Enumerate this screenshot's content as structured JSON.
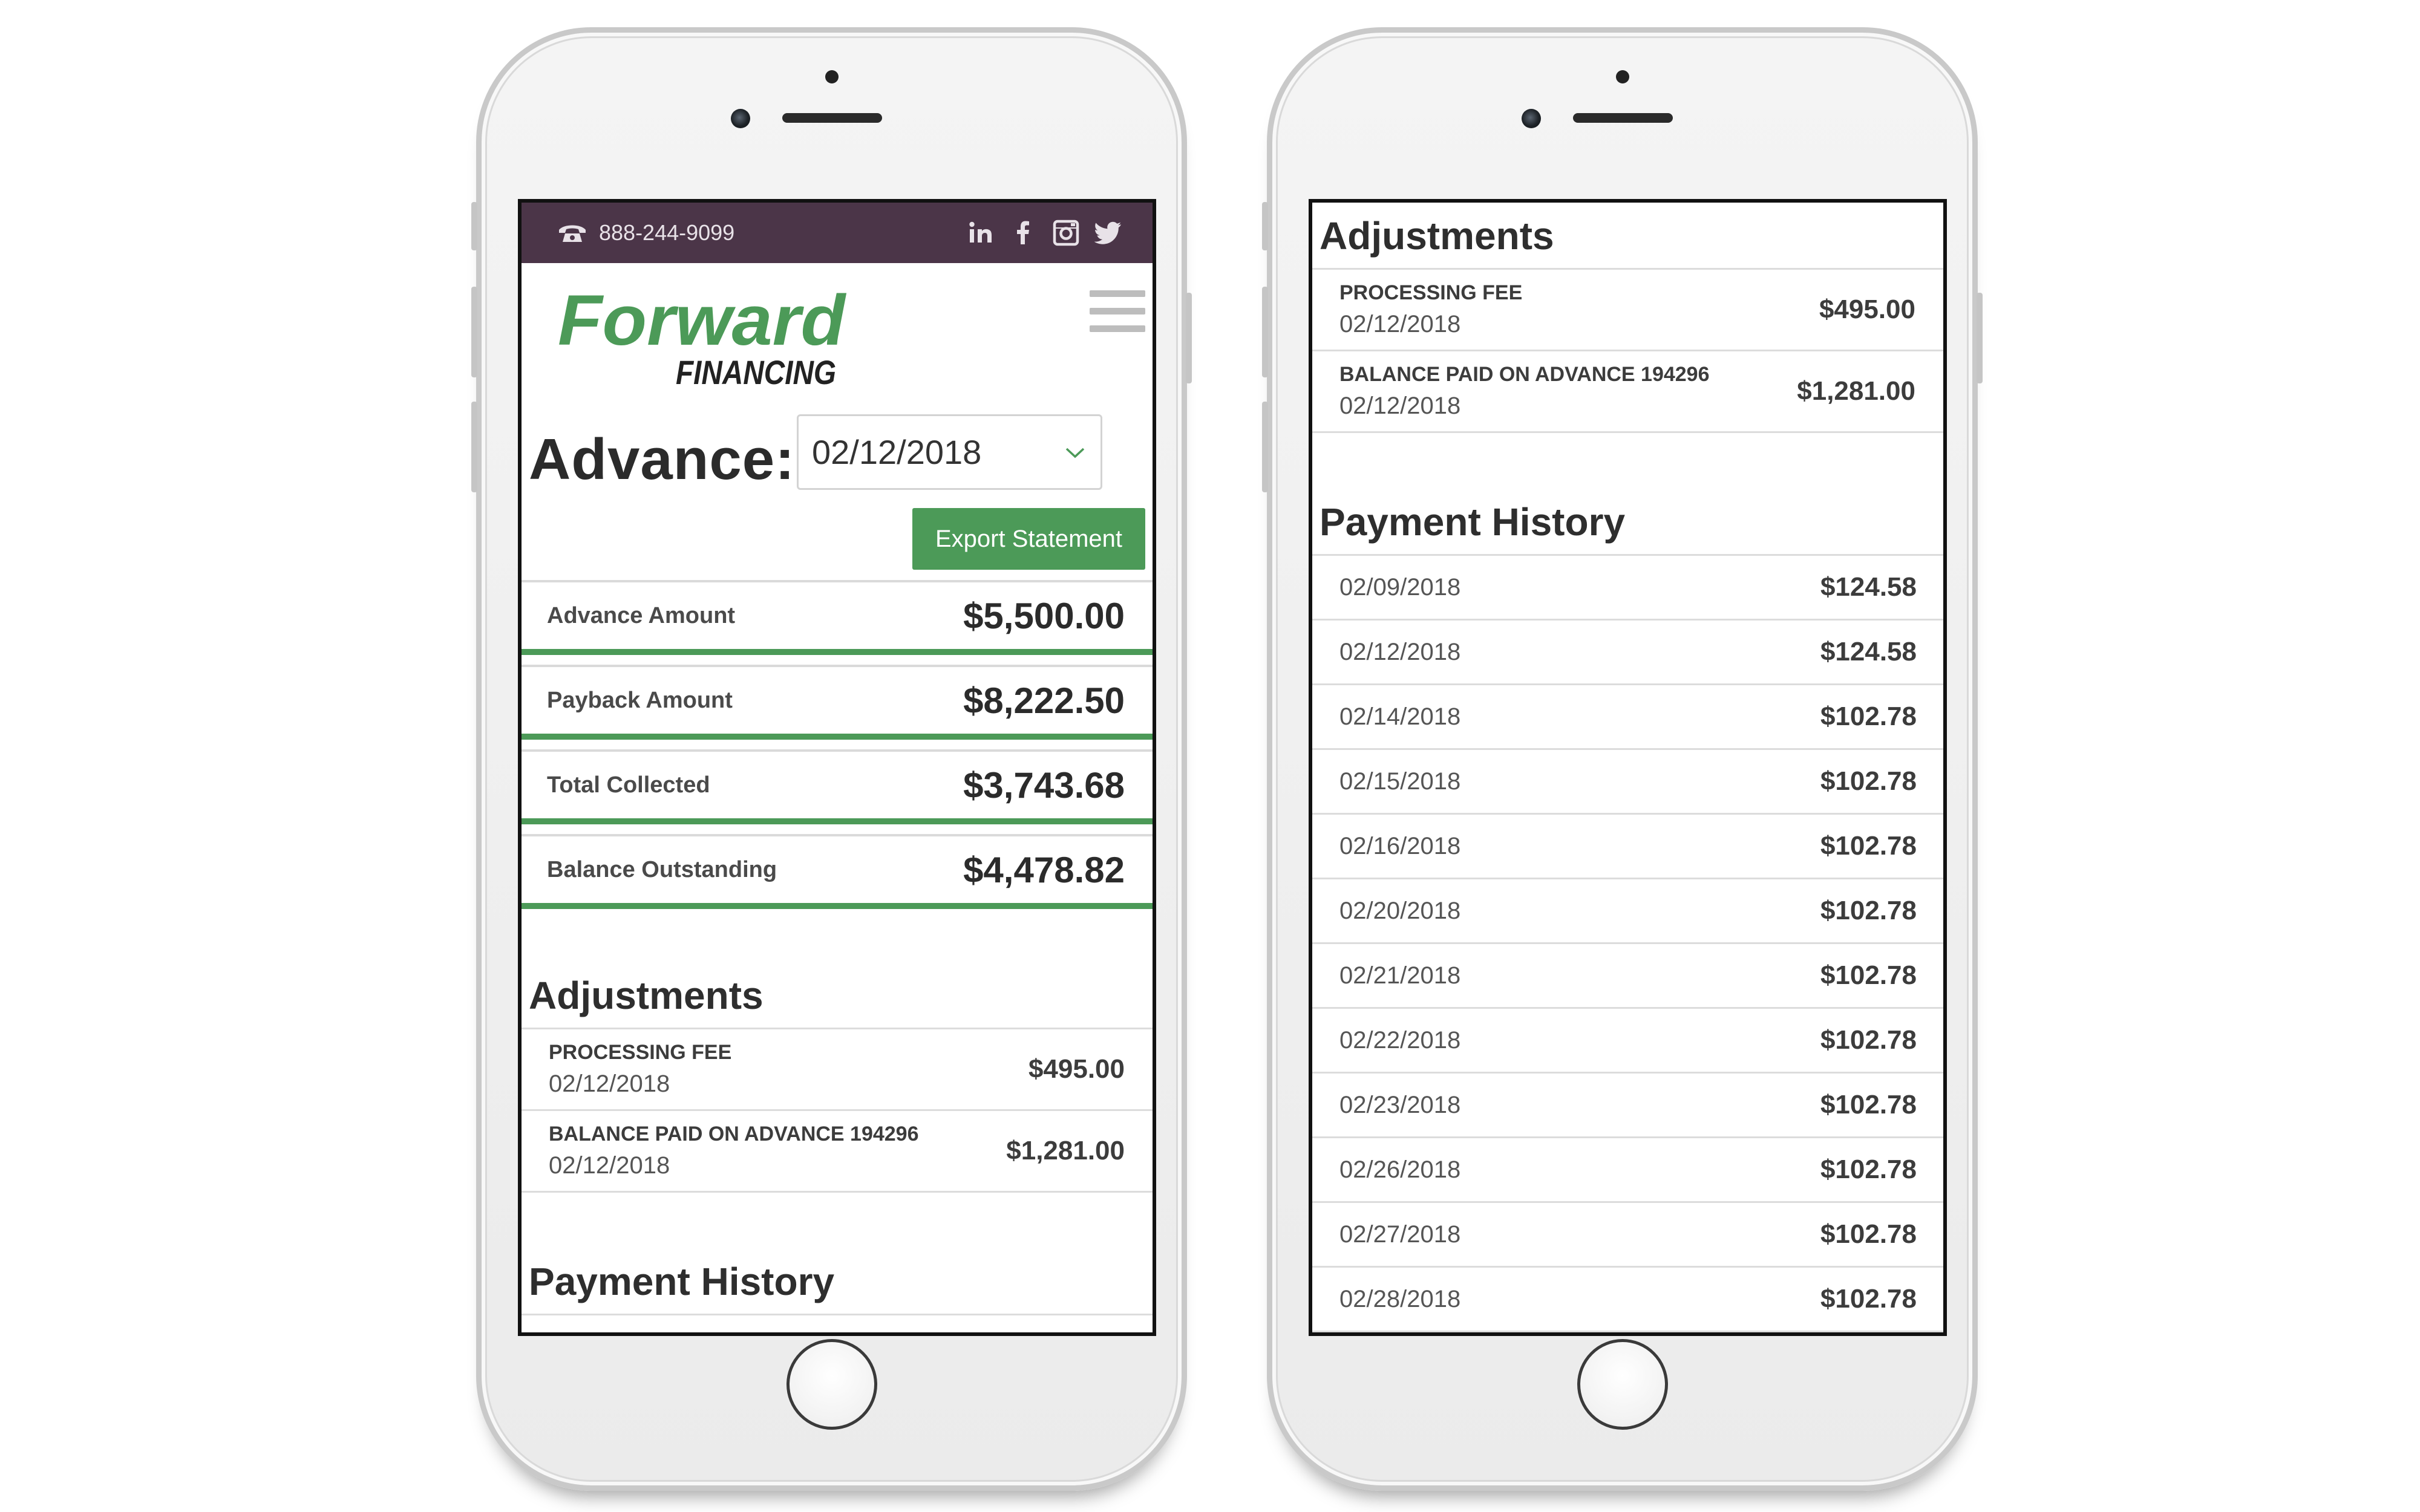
{
  "topbar": {
    "phone": "888-244-9099",
    "social_icons": [
      "linkedin-icon",
      "facebook-icon",
      "instagram-icon",
      "twitter-icon"
    ],
    "background": "#4b3548"
  },
  "brand": {
    "logo_word": "Forward",
    "logo_sub": "FINANCING",
    "primary_color": "#4c9a58"
  },
  "advance": {
    "label": "Advance:",
    "selected_date": "02/12/2018"
  },
  "export_label": "Export Statement",
  "summary": [
    {
      "label": "Advance Amount",
      "amount": "$5,500.00"
    },
    {
      "label": "Payback Amount",
      "amount": "$8,222.50"
    },
    {
      "label": "Total Collected",
      "amount": "$3,743.68"
    },
    {
      "label": "Balance Outstanding",
      "amount": "$4,478.82"
    }
  ],
  "adjustments": {
    "title": "Adjustments",
    "items": [
      {
        "name": "PROCESSING FEE",
        "date": "02/12/2018",
        "amount": "$495.00"
      },
      {
        "name": "BALANCE PAID ON ADVANCE 194296",
        "date": "02/12/2018",
        "amount": "$1,281.00"
      }
    ]
  },
  "payment_history": {
    "title": "Payment History",
    "items": [
      {
        "date": "02/09/2018",
        "amount": "$124.58"
      },
      {
        "date": "02/12/2018",
        "amount": "$124.58"
      },
      {
        "date": "02/14/2018",
        "amount": "$102.78"
      },
      {
        "date": "02/15/2018",
        "amount": "$102.78"
      },
      {
        "date": "02/16/2018",
        "amount": "$102.78"
      },
      {
        "date": "02/20/2018",
        "amount": "$102.78"
      },
      {
        "date": "02/21/2018",
        "amount": "$102.78"
      },
      {
        "date": "02/22/2018",
        "amount": "$102.78"
      },
      {
        "date": "02/23/2018",
        "amount": "$102.78"
      },
      {
        "date": "02/26/2018",
        "amount": "$102.78"
      },
      {
        "date": "02/27/2018",
        "amount": "$102.78"
      },
      {
        "date": "02/28/2018",
        "amount": "$102.78"
      }
    ]
  }
}
